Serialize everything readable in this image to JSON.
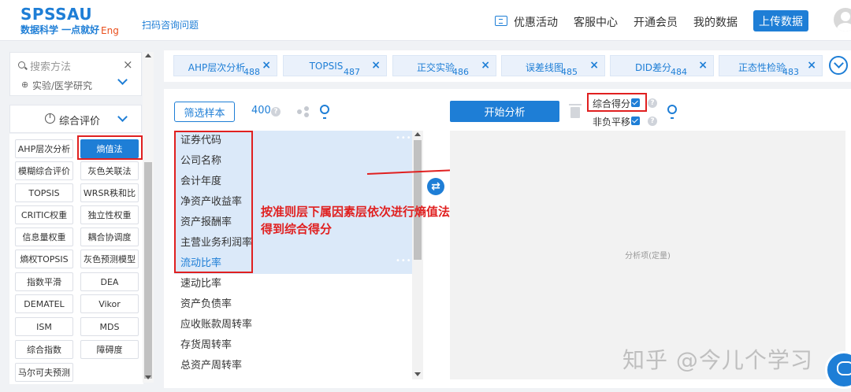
{
  "header": {
    "logo": "SPSSAU",
    "slogan": "数据科学 一点就好",
    "eng": "Eng",
    "scan_link": "扫码咨询问题",
    "nav": [
      "优惠活动",
      "客服中心",
      "开通会员",
      "我的数据"
    ],
    "upload": "上传数据"
  },
  "sidebar": {
    "search_placeholder": "搜索方法",
    "search_close": "×",
    "sub_category": "实验/医学研究",
    "category": "综合评价",
    "methods": [
      "AHP层次分析",
      "熵值法",
      "模糊综合评价",
      "灰色关联法",
      "TOPSIS",
      "WRSR秩和比",
      "CRITIC权重",
      "独立性权重",
      "信息量权重",
      "耦合协调度",
      "熵权TOPSIS",
      "灰色预测模型",
      "指数平滑",
      "DEA",
      "DEMATEL",
      "Vikor",
      "ISM",
      "MDS",
      "综合指数",
      "障碍度",
      "马尔可夫预测"
    ]
  },
  "tabs": [
    {
      "label": "AHP层次分析",
      "count": "488"
    },
    {
      "label": "TOPSIS",
      "count": "487"
    },
    {
      "label": "正交实验",
      "count": "486"
    },
    {
      "label": "误差线图",
      "count": "485"
    },
    {
      "label": "DID差分",
      "count": "484"
    },
    {
      "label": "正态性检验",
      "count": "483"
    }
  ],
  "toolbar": {
    "filter": "筛选样本",
    "count": "400",
    "start": "开始分析",
    "option1": "综合得分",
    "option2": "非负平移"
  },
  "variables": [
    "证券代码",
    "公司名称",
    "会计年度",
    "净资产收益率",
    "资产报酬率",
    "主营业务利润率",
    "流动比率",
    "速动比率",
    "资产负债率",
    "应收账款周转率",
    "存货周转率",
    "总资产周转率"
  ],
  "analysis_placeholder": "分析项(定量)",
  "annotation": [
    "按准则层下属因素层依次进行熵值法",
    "得到综合得分"
  ],
  "watermark": "知乎 @今儿个学习",
  "colors": {
    "brand": "#1e7ed6",
    "highlight": "#e02020"
  }
}
